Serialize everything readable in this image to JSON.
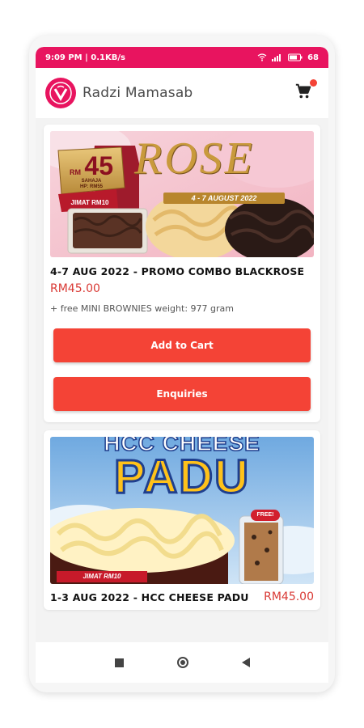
{
  "status_bar": {
    "time": "9:09 PM | 0.1KB/s",
    "battery": "68"
  },
  "app": {
    "name": "Radzi Mamasab"
  },
  "products": [
    {
      "banner": {
        "promo_amount": "45",
        "promo_prefix": "RM",
        "promo_small": "SAHAJA\nHP: RM55",
        "jimat": "JIMAT RM10",
        "headline": "ROSE",
        "dates": "4 - 7 AUGUST 2022"
      },
      "title": "4-7 AUG 2022 - PROMO COMBO BLACKROSE",
      "price": "RM45.00",
      "description": "+ free MINI BROWNIES weight: 977 gram",
      "add_to_cart_label": "Add to Cart",
      "enquiries_label": "Enquiries"
    },
    {
      "banner": {
        "top_text": "HCC CHEESE",
        "headline": "PADU",
        "free_badge": "FREE!",
        "jimat": "JIMAT RM10"
      },
      "title": "1-3 AUG 2022 - HCC CHEESE PADU",
      "price": "RM45.00"
    }
  ],
  "colors": {
    "brand": "#e8145f",
    "button": "#f44336",
    "price": "#d93a35"
  }
}
